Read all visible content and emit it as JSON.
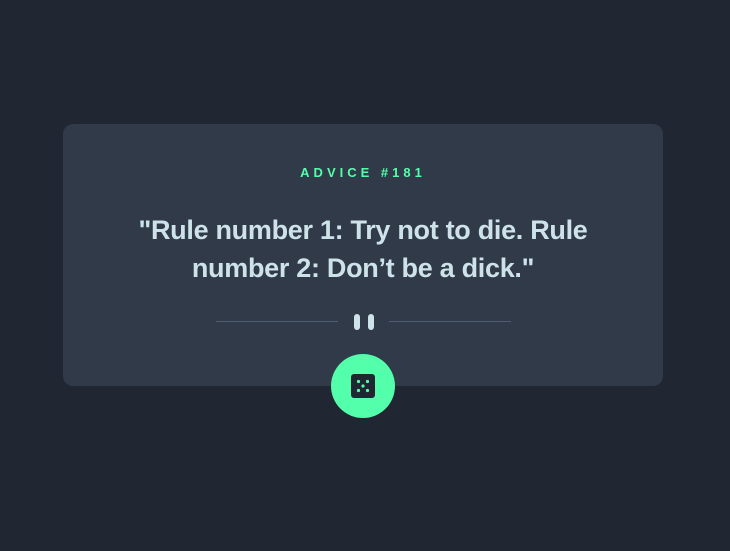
{
  "advice": {
    "label": "ADVICE #181",
    "quote": "\"Rule number 1: Try not to die. Rule number 2: Don’t be a dick.\""
  },
  "icons": {
    "divider": "pause-icon",
    "button": "dice-icon"
  },
  "colors": {
    "background": "#202632",
    "card": "#313a49",
    "accent": "#53ffaa",
    "text": "#cee3e9",
    "divider": "#4f5d74"
  }
}
